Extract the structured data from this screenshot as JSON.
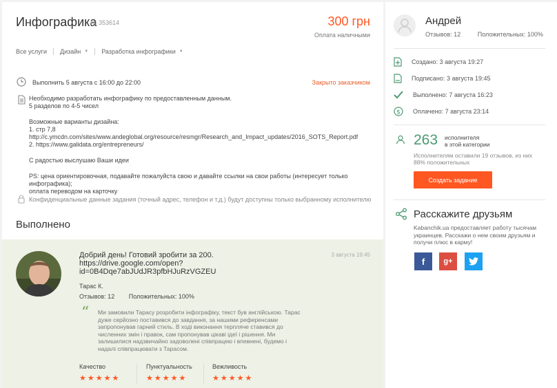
{
  "task": {
    "title": "Инфографика",
    "number": "№ 353614",
    "price": "300 грн",
    "payment": "Оплата наличными",
    "breadcrumbs": [
      "Все услуги",
      "Дизайн",
      "Разработка инфографики"
    ],
    "deadline": "Выполнить 5 августа с 16:00 до 22:00",
    "picked_by": "Закрыто заказчиком",
    "description": [
      "Необходимо разработать инфографику по предоставленным данным.",
      "5 разделов по 4-5 чисел",
      "",
      "Возможные варианты дизайна:",
      "1. стр 7,8",
      "http://c.ymcdn.com/sites/www.andeglobal.org/resource/resmgr/Research_and_Impact_updates/2016_SOTS_Report.pdf",
      "2. https://www.galidata.org/entrepreneurs/",
      "",
      "С радостью выслушаю Ваши идеи",
      "",
      "PS: цена ориентировочная, подавайте пожалуйста свою и давайте ссылки на свои работы (интересует только инфографика);",
      "оплата переводом на карточку"
    ],
    "confidential_note": "Конфиденциальные данные задания (точный адрес, телефон и т.д.) будут доступны только выбранному исполнителю"
  },
  "done_section": {
    "title": "Выполнено",
    "message": "Добрий день! Готовий зробити за 200. https://drive.google.com/open?id=0B4Dqe7abJUdJR3pfbHJuRzVGZEU",
    "date": "3 августа 19:45",
    "performer_name": "Тарас К.",
    "performer_reviews": "Отзывов: 12",
    "performer_positive": "Положительных: 100%",
    "review_text": "Ми замовили Тарасу розробити інфографіку, текст був англійською. Тарас дуже серйозно поставився до завдання, за нашими референсами запропонував гарний стиль. В ході виконання терпляче ставився до численних змін і правок, сам пропонував цікаві ідеї і рішення. Ми залишилися надзвичайно задоволені співпрацею і впевнені, будемо і надалі співпрацювати з Тарасом.",
    "ratings": [
      {
        "label": "Качество",
        "stars": "★★★★★"
      },
      {
        "label": "Пунктуальность",
        "stars": "★★★★★"
      },
      {
        "label": "Вежливость",
        "stars": "★★★★★"
      }
    ]
  },
  "client": {
    "name": "Андрей",
    "reviews": "Отзывов: 12",
    "positive": "Положительных: 100%"
  },
  "statuses": [
    {
      "label": "Создано:",
      "value": "3 августа 19:27",
      "icon": "doc-plus-icon"
    },
    {
      "label": "Подписано:",
      "value": "3 августа 19:45",
      "icon": "doc-sign-icon"
    },
    {
      "label": "Выполнено:",
      "value": "7 августа 16:23",
      "icon": "check-icon"
    },
    {
      "label": "Оплачено:",
      "value": "7 августа 23:14",
      "icon": "dollar-icon"
    }
  ],
  "performers": {
    "count": "263",
    "label_line1": "исполнителя",
    "label_line2": "в этой категории",
    "note": "Исполнителям оставили 19 отзывов, из них 88% положительных",
    "button": "Создать задание"
  },
  "share": {
    "title": "Расскажите друзьям",
    "text": "Kabanchik.ua предоставляет работу тысячам украинцев. Расскажи о нем своим друзьям и получи плюс в карму!",
    "facebook": "f",
    "google": "g+"
  },
  "colors": {
    "accent": "#ff5722",
    "green": "#4c9a72",
    "review_bg": "#eef1e6",
    "facebook": "#3b5998",
    "google": "#dc4e41",
    "twitter": "#1da1f2"
  }
}
